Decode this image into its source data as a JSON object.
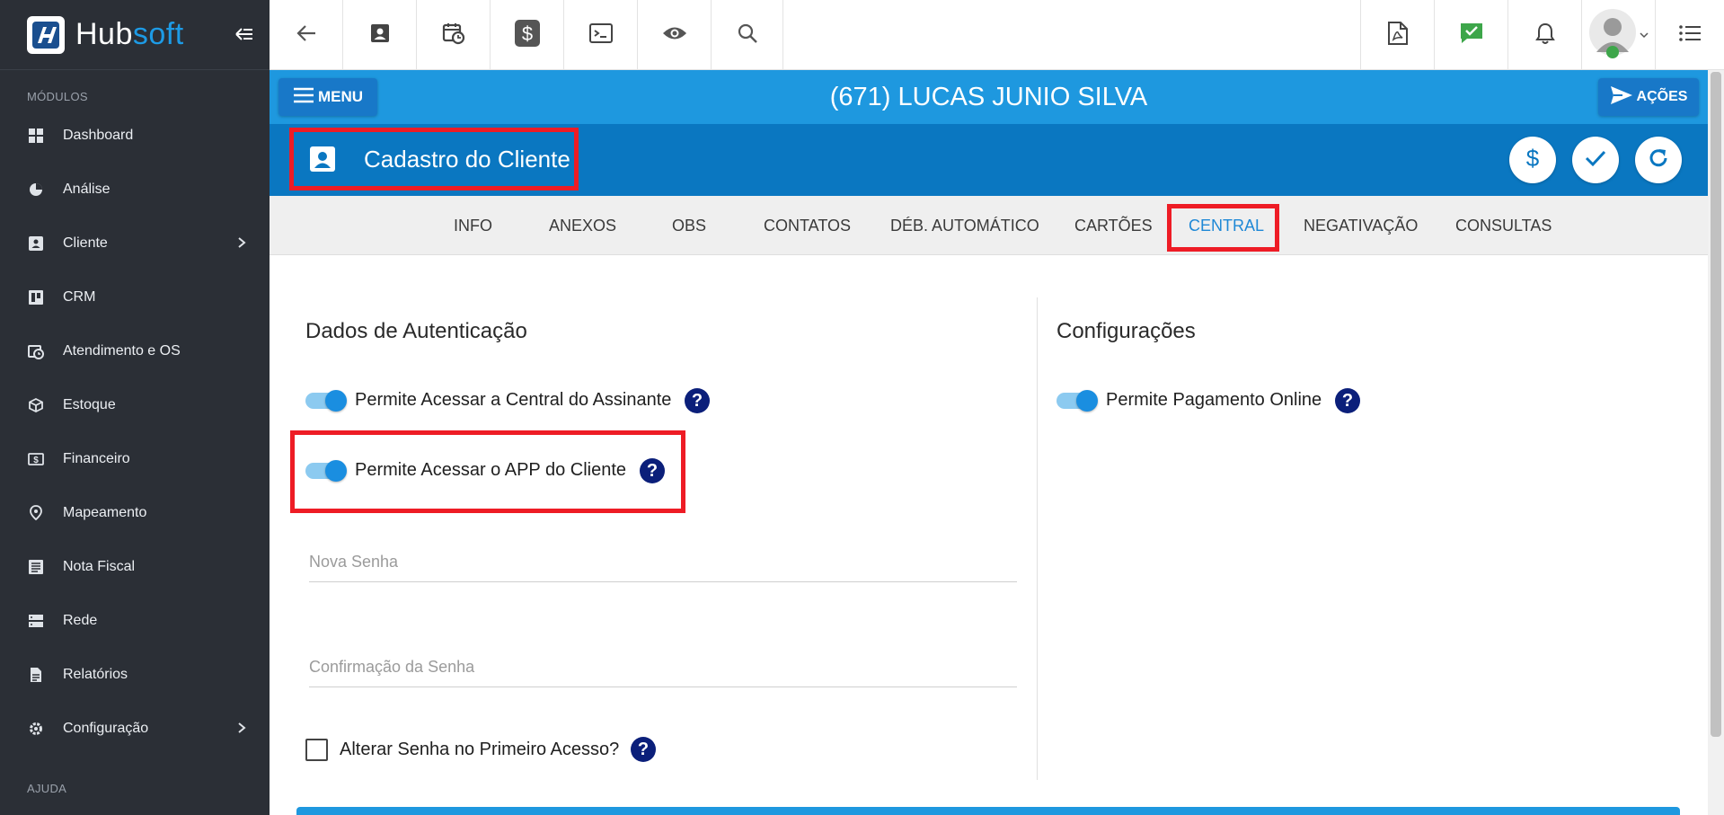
{
  "app": {
    "logo_hub": "Hub",
    "logo_soft": "soft"
  },
  "sidebar": {
    "section_modules": "MÓDULOS",
    "items": [
      {
        "label": "Dashboard",
        "icon": "dashboard-icon"
      },
      {
        "label": "Análise",
        "icon": "pie-chart-icon"
      },
      {
        "label": "Cliente",
        "icon": "contact-card-icon",
        "has_submenu": true
      },
      {
        "label": "CRM",
        "icon": "kanban-board-icon"
      },
      {
        "label": "Atendimento e OS",
        "icon": "calendar-clock-icon"
      },
      {
        "label": "Estoque",
        "icon": "box-icon"
      },
      {
        "label": "Financeiro",
        "icon": "money-icon"
      },
      {
        "label": "Mapeamento",
        "icon": "map-pin-icon"
      },
      {
        "label": "Nota Fiscal",
        "icon": "document-list-icon"
      },
      {
        "label": "Rede",
        "icon": "server-icon"
      },
      {
        "label": "Relatórios",
        "icon": "report-file-icon"
      },
      {
        "label": "Configuração",
        "icon": "gear-icon",
        "has_submenu": true
      }
    ],
    "section_help": "AJUDA"
  },
  "topbar": {
    "icons": [
      "back-arrow-icon",
      "contact-card-icon",
      "calendar-clock-icon",
      "dollar-icon",
      "terminal-icon",
      "eye-icon",
      "search-icon",
      "pdf-icon",
      "chat-check-icon",
      "bell-icon",
      "avatar",
      "list-icon"
    ]
  },
  "header": {
    "menu_label": "MENU",
    "client_name": "(671) LUCAS JUNIO SILVA",
    "actions_label": "AÇÕES",
    "page_title": "Cadastro do Cliente"
  },
  "tabs": [
    {
      "label": "INFO",
      "active": false
    },
    {
      "label": "ANEXOS",
      "active": false
    },
    {
      "label": "OBS",
      "active": false
    },
    {
      "label": "CONTATOS",
      "active": false
    },
    {
      "label": "DÉB. AUTOMÁTICO",
      "active": false
    },
    {
      "label": "CARTÕES",
      "active": false
    },
    {
      "label": "CENTRAL",
      "active": true
    },
    {
      "label": "NEGATIVAÇÃO",
      "active": false
    },
    {
      "label": "CONSULTAS",
      "active": false
    }
  ],
  "auth": {
    "title": "Dados de Autenticação",
    "allow_central_label": "Permite Acessar a Central do Assinante",
    "allow_central_on": true,
    "allow_app_label": "Permite Acessar o APP do Cliente",
    "allow_app_on": true,
    "new_password_placeholder": "Nova Senha",
    "confirm_password_placeholder": "Confirmação da Senha",
    "change_first_access_label": "Alterar Senha no Primeiro Acesso?",
    "change_first_access_checked": false
  },
  "config": {
    "title": "Configurações",
    "allow_online_payment_label": "Permite Pagamento Online",
    "allow_online_payment_on": true
  },
  "colors": {
    "sidebar_bg": "#2b2f36",
    "header_blue": "#1e98df",
    "title_blue": "#0a77c1",
    "highlight_red": "#ee1c25",
    "help_navy": "#0b1f7a"
  }
}
